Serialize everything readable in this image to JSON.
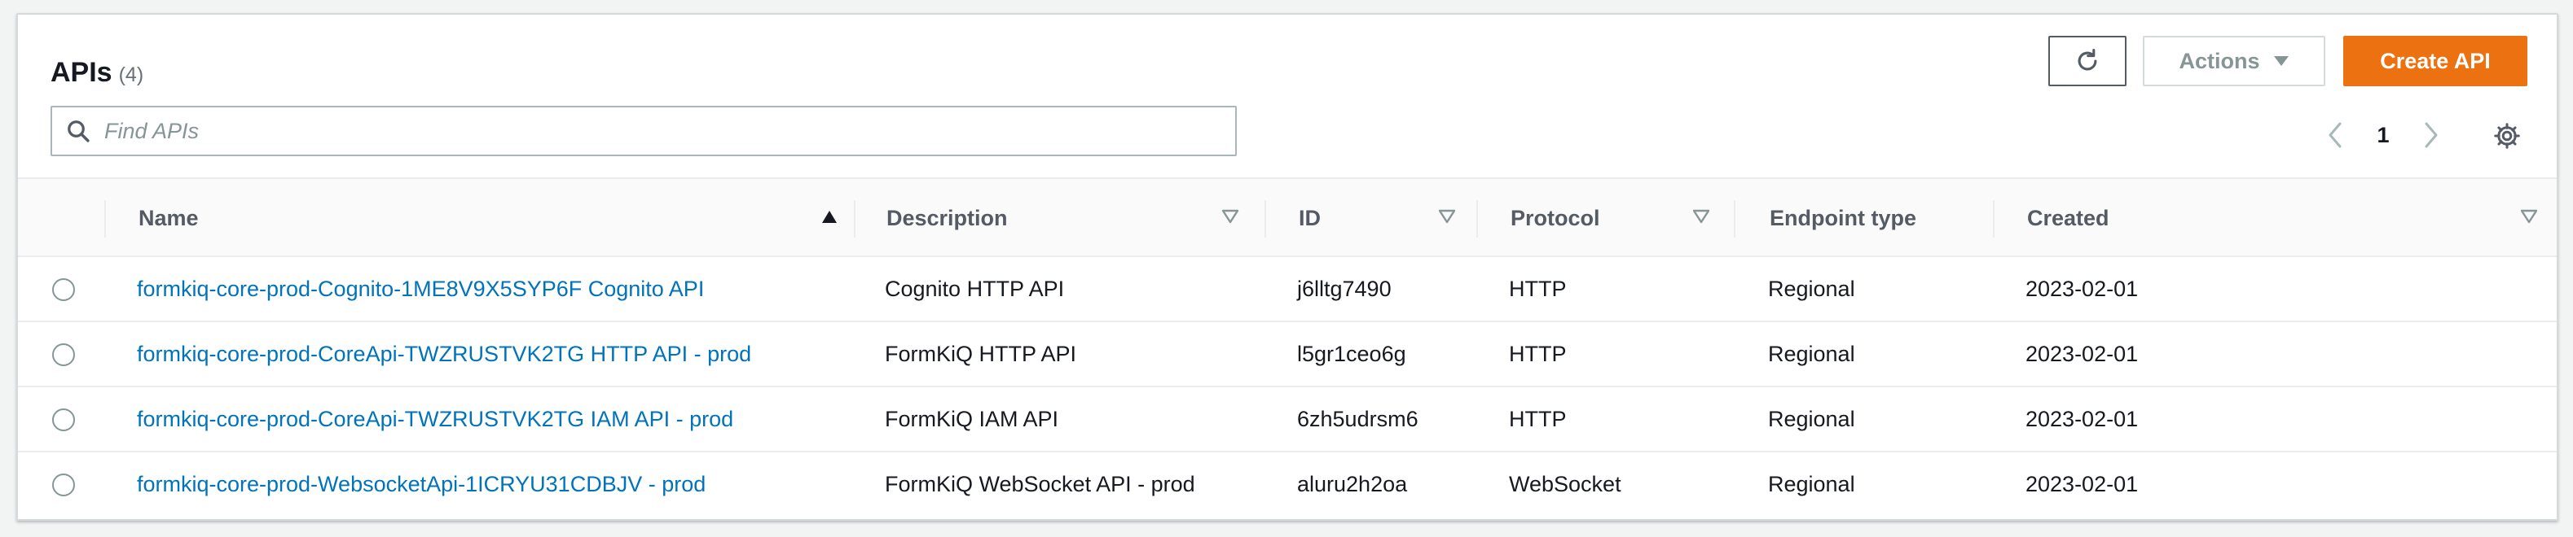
{
  "header": {
    "title": "APIs",
    "count": "(4)",
    "actions_label": "Actions",
    "create_label": "Create API"
  },
  "search": {
    "placeholder": "Find APIs",
    "value": ""
  },
  "pagination": {
    "current_page": "1"
  },
  "table": {
    "columns": [
      "Name",
      "Description",
      "ID",
      "Protocol",
      "Endpoint type",
      "Created"
    ],
    "rows": [
      {
        "name": "formkiq-core-prod-Cognito-1ME8V9X5SYP6F Cognito API",
        "description": "Cognito HTTP API",
        "id": "j6lltg7490",
        "protocol": "HTTP",
        "endpoint_type": "Regional",
        "created": "2023-02-01"
      },
      {
        "name": "formkiq-core-prod-CoreApi-TWZRUSTVK2TG HTTP API - prod",
        "description": "FormKiQ HTTP API",
        "id": "l5gr1ceo6g",
        "protocol": "HTTP",
        "endpoint_type": "Regional",
        "created": "2023-02-01"
      },
      {
        "name": "formkiq-core-prod-CoreApi-TWZRUSTVK2TG IAM API - prod",
        "description": "FormKiQ IAM API",
        "id": "6zh5udrsm6",
        "protocol": "HTTP",
        "endpoint_type": "Regional",
        "created": "2023-02-01"
      },
      {
        "name": "formkiq-core-prod-WebsocketApi-1ICRYU31CDBJV - prod",
        "description": "FormKiQ WebSocket API - prod",
        "id": "aluru2h2oa",
        "protocol": "WebSocket",
        "endpoint_type": "Regional",
        "created": "2023-02-01"
      }
    ]
  },
  "icons": {
    "refresh": "refresh-icon",
    "actions_caret": "caret-down-icon",
    "search": "search-icon",
    "prev": "chevron-left-icon",
    "next": "chevron-right-icon",
    "settings": "gear-icon",
    "sort_asc": "sort-ascending-icon",
    "sort_none": "sort-descending-outline-icon"
  },
  "colors": {
    "primary": "#ec7211",
    "link": "#0073bb",
    "text": "#16191f",
    "muted": "#879596"
  }
}
